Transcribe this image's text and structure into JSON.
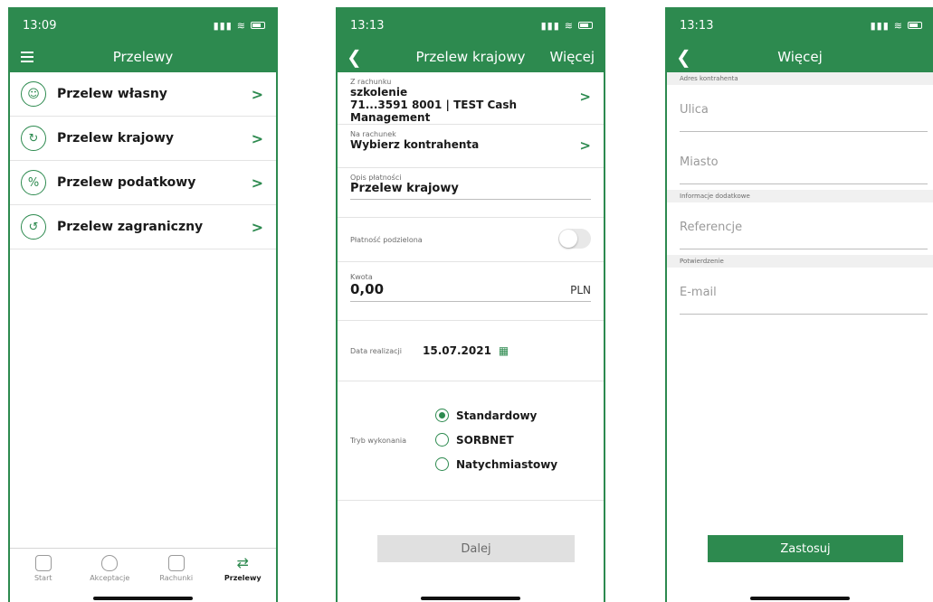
{
  "colors": {
    "brand_green": "#2d8a4f",
    "button_gray": "#e0e0e0"
  },
  "screen1": {
    "time": "13:09",
    "title": "Przelewy",
    "menu": [
      {
        "label": "Przelew własny",
        "icon": "person-money-icon"
      },
      {
        "label": "Przelew krajowy",
        "icon": "transfer-icon"
      },
      {
        "label": "Przelew podatkowy",
        "icon": "percent-icon"
      },
      {
        "label": "Przelew zagraniczny",
        "icon": "globe-transfer-icon"
      }
    ],
    "tabs": [
      "Start",
      "Akceptacje",
      "Rachunki",
      "Przelewy"
    ]
  },
  "screen2": {
    "time": "13:13",
    "title": "Przelew krajowy",
    "more": "Więcej",
    "from_label": "Z rachunku",
    "from_name": "szkolenie",
    "from_account": "71...3591 8001 | TEST Cash Management",
    "to_label": "Na rachunek",
    "to_value": "Wybierz kontrahenta",
    "desc_label": "Opis płatności",
    "desc_value": "Przelew krajowy",
    "split_label": "Płatność podzielona",
    "amount_label": "Kwota",
    "amount_value": "0,00",
    "currency": "PLN",
    "date_label": "Data realizacji",
    "date_value": "15.07.2021",
    "mode_label": "Tryb wykonania",
    "modes": [
      "Standardowy",
      "SORBNET",
      "Natychmiastowy"
    ],
    "next_button": "Dalej"
  },
  "screen3": {
    "time": "13:13",
    "title": "Więcej",
    "section_address": "Adres kontrahenta",
    "street_placeholder": "Ulica",
    "city_placeholder": "Miasto",
    "section_info": "Informacje dodatkowe",
    "reference_placeholder": "Referencje",
    "section_confirm": "Potwierdzenie",
    "email_placeholder": "E-mail",
    "apply_button": "Zastosuj"
  }
}
